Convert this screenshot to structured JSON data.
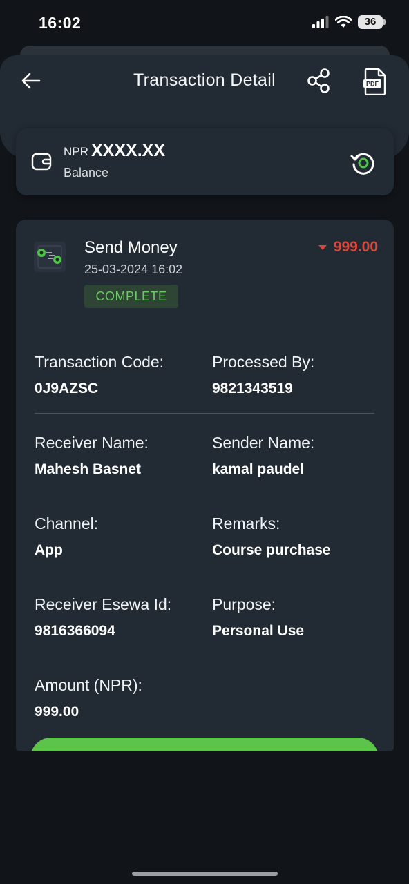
{
  "status_bar": {
    "time": "16:02",
    "battery": "36"
  },
  "header": {
    "title": "Transaction Detail"
  },
  "balance": {
    "currency": "NPR",
    "amount": "XXXX.XX",
    "label": "Balance"
  },
  "transaction": {
    "title": "Send Money",
    "datetime": "25-03-2024 16:02",
    "status": "COMPLETE",
    "amount": "999.00"
  },
  "fields": {
    "transaction_code": {
      "label": "Transaction Code:",
      "value": "0J9AZSC"
    },
    "processed_by": {
      "label": "Processed By:",
      "value": "9821343519"
    },
    "receiver_name": {
      "label": "Receiver Name:",
      "value": "Mahesh Basnet"
    },
    "sender_name": {
      "label": "Sender Name:",
      "value": "kamal paudel"
    },
    "channel": {
      "label": "Channel:",
      "value": "App"
    },
    "remarks": {
      "label": "Remarks:",
      "value": "Course purchase"
    },
    "receiver_esewa_id": {
      "label": "Receiver Esewa Id:",
      "value": "9816366094"
    },
    "purpose": {
      "label": "Purpose:",
      "value": "Personal Use"
    },
    "amount_npr": {
      "label": "Amount (NPR):",
      "value": "999.00"
    }
  },
  "colors": {
    "background": "#111418",
    "card": "#222a33",
    "accent_green": "#5cc44a",
    "status_green": "#6cc965",
    "debit_red": "#d9463a"
  },
  "icons": {
    "back": "arrow-left-icon",
    "share": "share-icon",
    "pdf": "pdf-icon",
    "wallet": "wallet-icon",
    "refresh": "refresh-icon",
    "transaction": "send-money-icon"
  }
}
